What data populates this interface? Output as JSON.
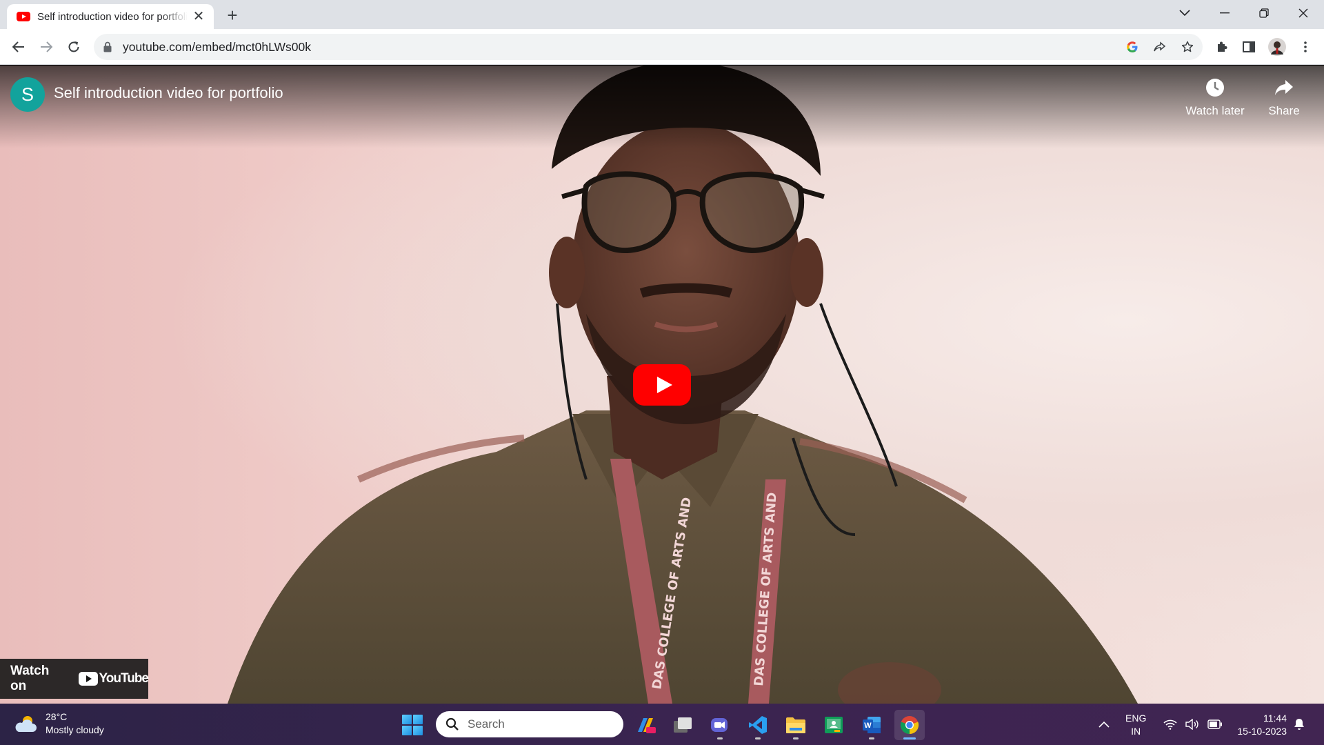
{
  "browser": {
    "tab": {
      "title": "Self introduction video for portfolio",
      "favicon": "youtube-favicon"
    },
    "address_bar": {
      "url": "youtube.com/embed/mct0hLWs00k"
    }
  },
  "video": {
    "channel_initial": "S",
    "title": "Self introduction video for portfolio",
    "actions": {
      "watch_later": "Watch later",
      "share": "Share"
    },
    "watch_on_label": "Watch on",
    "youtube_wordmark": "YouTube",
    "lanyard_text": "DAS COLLEGE OF ARTS AND"
  },
  "taskbar": {
    "weather": {
      "temperature": "28°C",
      "condition": "Mostly cloudy"
    },
    "search_placeholder": "Search",
    "apps": [
      "widgets-app",
      "task-view",
      "teams-chat",
      "vs-code",
      "file-explorer",
      "google-classroom",
      "word",
      "chrome"
    ],
    "language": {
      "lang": "ENG",
      "region": "IN"
    },
    "clock": {
      "time": "11:44",
      "date": "15-10-2023"
    }
  },
  "colors": {
    "youtube_red": "#ff0000",
    "taskbar": "#3a2450",
    "avatar": "#12a39c"
  }
}
